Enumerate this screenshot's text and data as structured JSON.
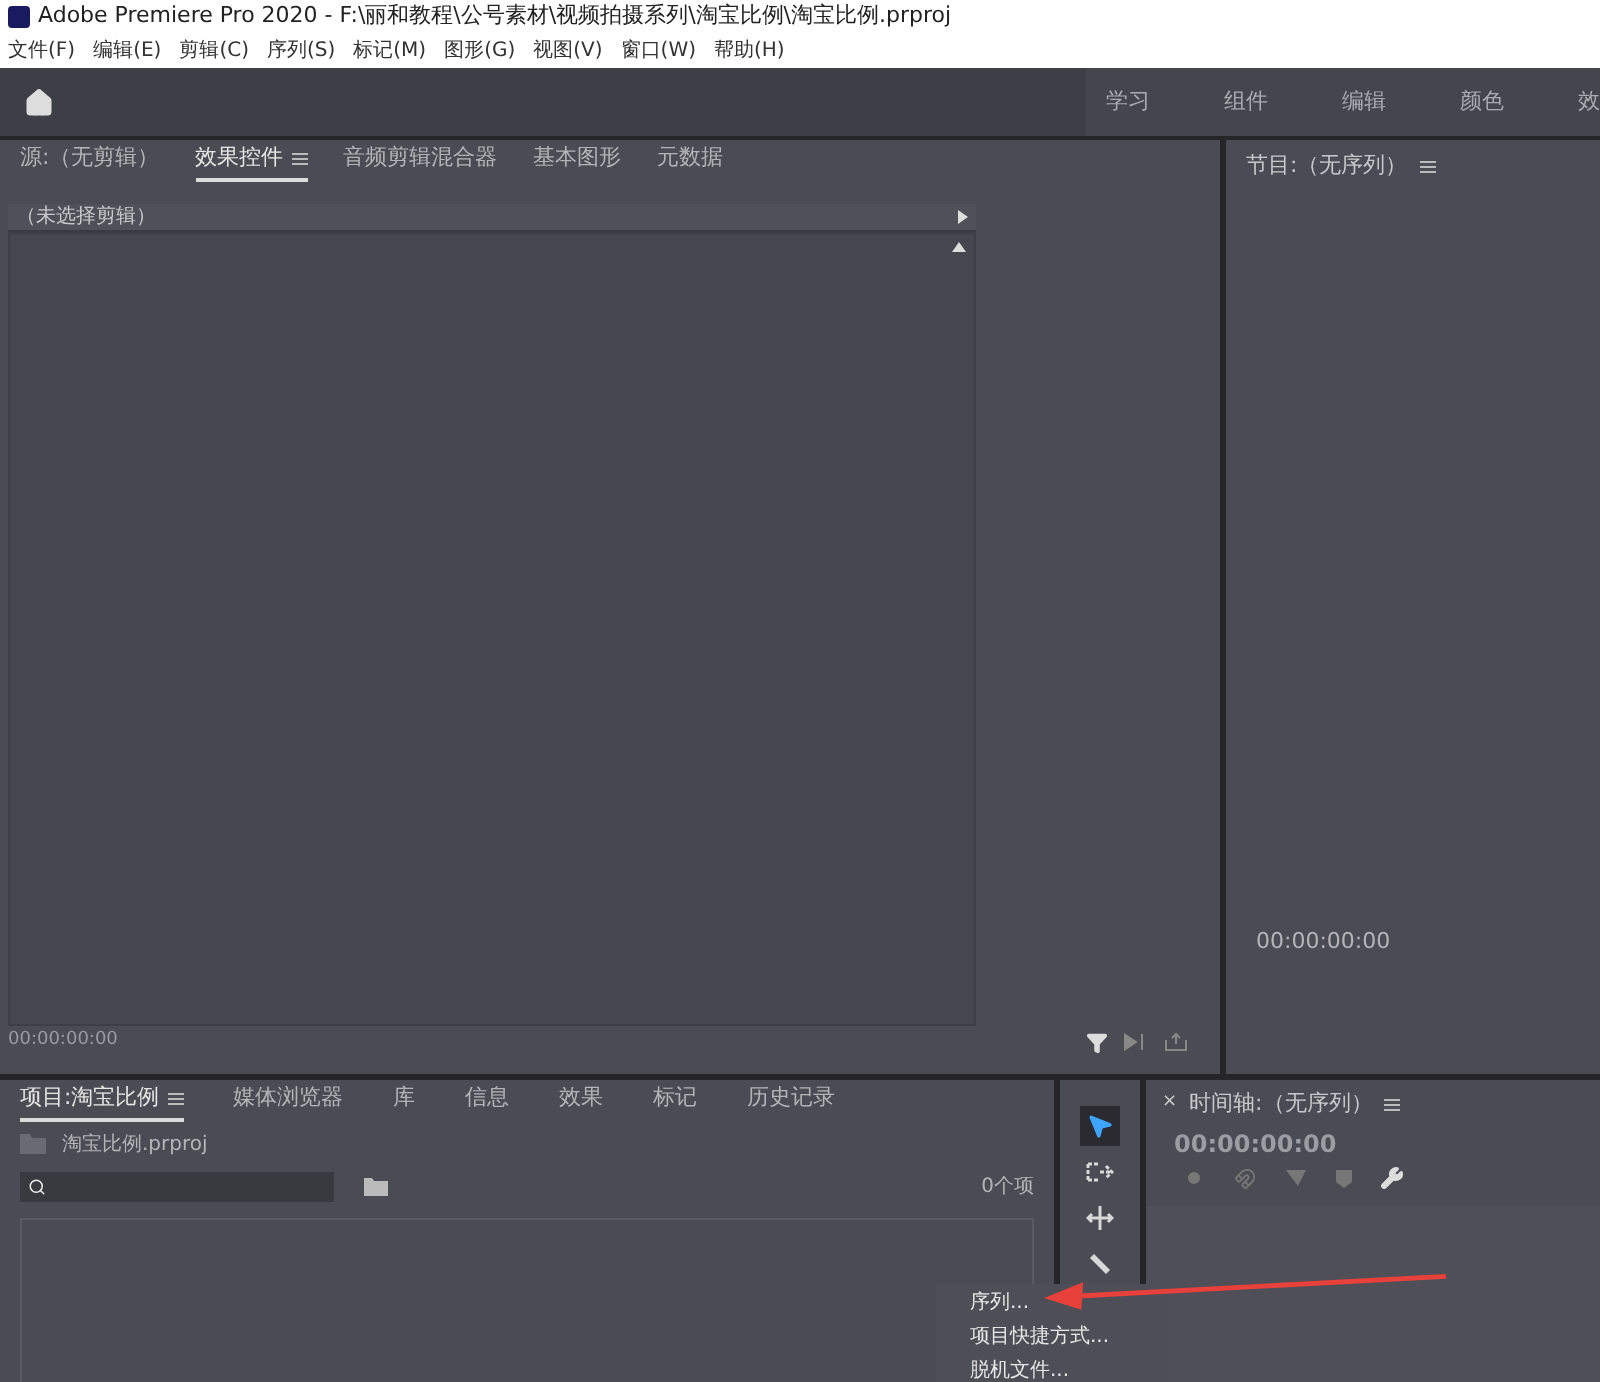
{
  "window": {
    "title": "Adobe Premiere Pro 2020 - F:\\丽和教程\\公号素材\\视频拍摄系列\\淘宝比例\\淘宝比例.prproj"
  },
  "menu_bar": [
    "文件(F)",
    "编辑(E)",
    "剪辑(C)",
    "序列(S)",
    "标记(M)",
    "图形(G)",
    "视图(V)",
    "窗口(W)",
    "帮助(H)"
  ],
  "workspaces": [
    {
      "label": "学习",
      "selected": false
    },
    {
      "label": "组件",
      "selected": false
    },
    {
      "label": "编辑",
      "selected": false
    },
    {
      "label": "颜色",
      "selected": false
    },
    {
      "label": "效",
      "selected": false
    }
  ],
  "source_panel": {
    "tabs": [
      {
        "label": "源:（无剪辑）",
        "selected": false,
        "menu": false
      },
      {
        "label": "效果控件",
        "selected": true,
        "menu": true
      },
      {
        "label": "音频剪辑混合器",
        "selected": false,
        "menu": false
      },
      {
        "label": "基本图形",
        "selected": false,
        "menu": false
      },
      {
        "label": "元数据",
        "selected": false,
        "menu": false
      }
    ],
    "clip_header": "（未选择剪辑）",
    "timecode": "00:00:00:00"
  },
  "program_panel": {
    "title": "节目:（无序列）",
    "timecode": "00:00:00:00"
  },
  "project_panel": {
    "tabs": [
      {
        "label": "项目:淘宝比例",
        "selected": true,
        "menu": true
      },
      {
        "label": "媒体浏览器",
        "selected": false,
        "menu": false
      },
      {
        "label": "库",
        "selected": false,
        "menu": false
      },
      {
        "label": "信息",
        "selected": false,
        "menu": false
      },
      {
        "label": "效果",
        "selected": false,
        "menu": false
      },
      {
        "label": "标记",
        "selected": false,
        "menu": false
      },
      {
        "label": "历史记录",
        "selected": false,
        "menu": false
      }
    ],
    "file": "淘宝比例.prproj",
    "item_count": "0个项"
  },
  "tools": [
    {
      "kind": "select",
      "selected": true
    },
    {
      "kind": "track",
      "selected": false
    },
    {
      "kind": "ripple",
      "selected": false
    },
    {
      "kind": "razor",
      "selected": false
    }
  ],
  "timeline_panel": {
    "close": "×",
    "title": "时间轴:（无序列）",
    "timecode": "00:00:00:00"
  },
  "context_menu": [
    "序列...",
    "项目快捷方式...",
    "脱机文件..."
  ]
}
